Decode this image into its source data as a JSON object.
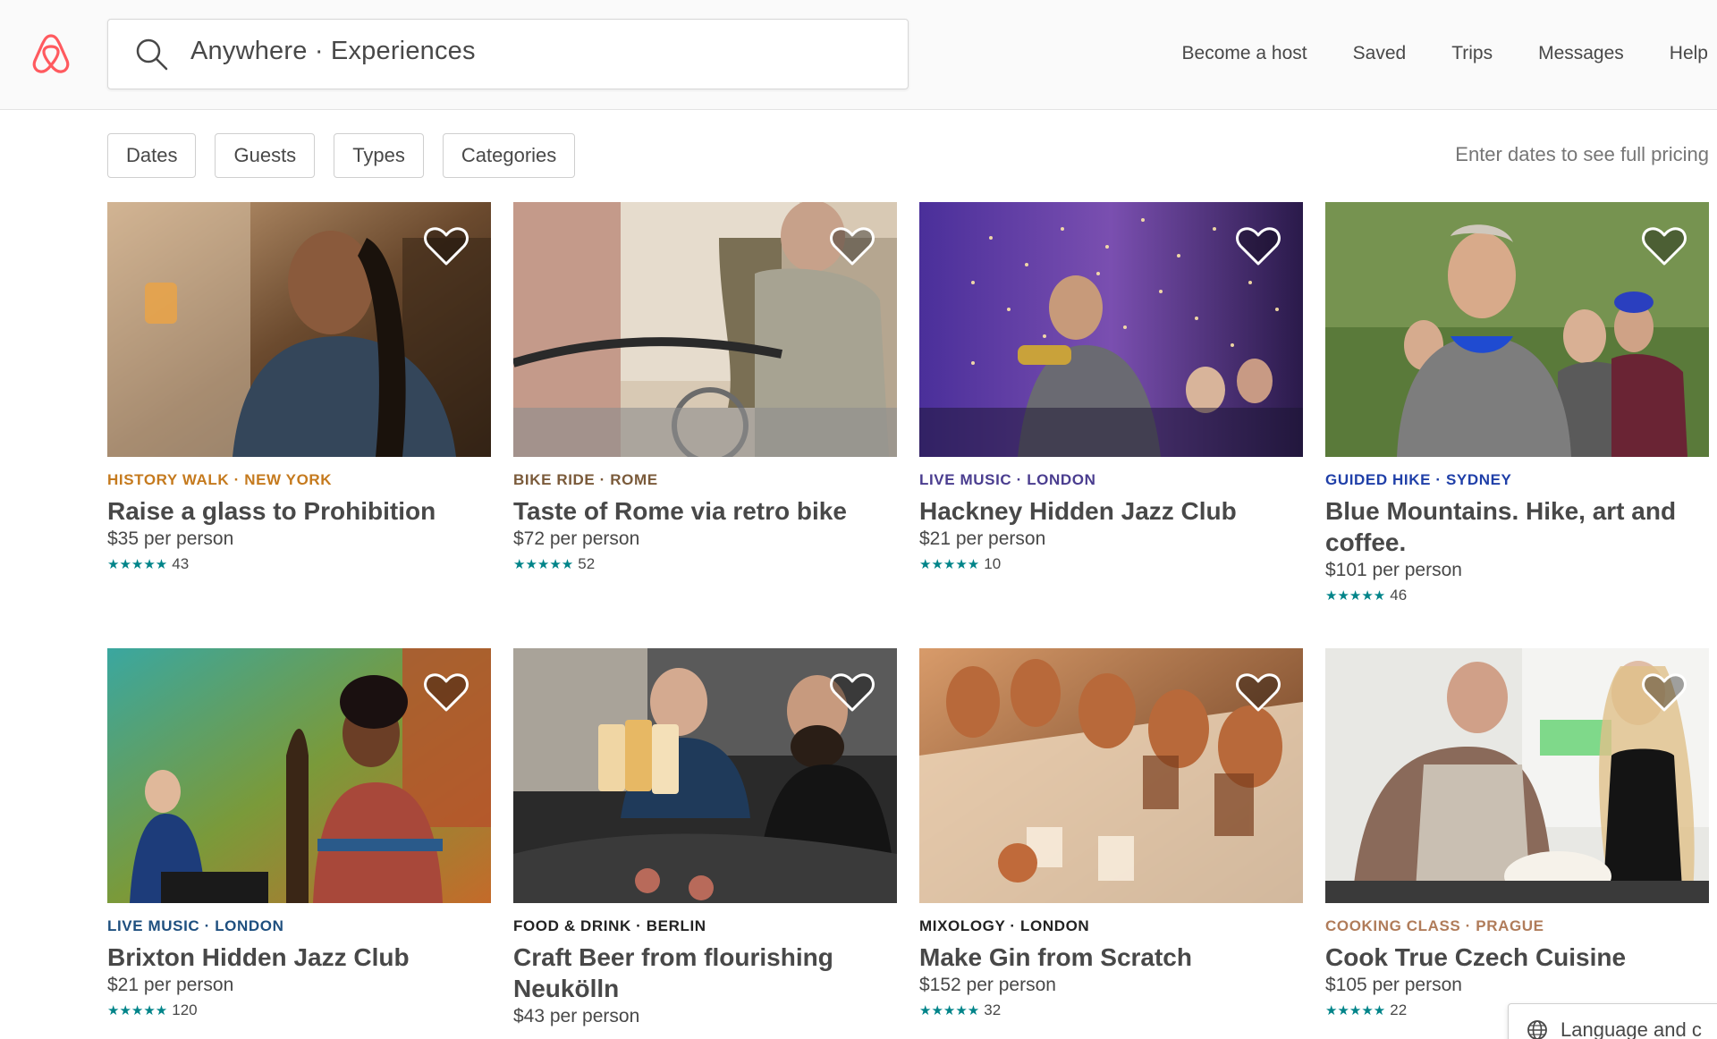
{
  "header": {
    "search_text": "Anywhere · Experiences",
    "nav": [
      "Become a host",
      "Saved",
      "Trips",
      "Messages",
      "Help"
    ]
  },
  "filters": {
    "buttons": [
      "Dates",
      "Guests",
      "Types",
      "Categories"
    ],
    "pricing_note": "Enter dates to see full pricing"
  },
  "listings": [
    {
      "category": "HISTORY WALK · NEW YORK",
      "category_color": "#c57a1e",
      "title": "Raise a glass to Prohibition",
      "price": "$35 per person",
      "stars": "★★★★★",
      "reviews": "43"
    },
    {
      "category": "BIKE RIDE · ROME",
      "category_color": "#7a5a3a",
      "title": "Taste of Rome via retro bike",
      "price": "$72 per person",
      "stars": "★★★★★",
      "reviews": "52"
    },
    {
      "category": "LIVE MUSIC · LONDON",
      "category_color": "#4a3d8f",
      "title": "Hackney Hidden Jazz Club",
      "price": "$21 per person",
      "stars": "★★★★★",
      "reviews": "10"
    },
    {
      "category": "GUIDED HIKE · SYDNEY",
      "category_color": "#1f3fa8",
      "title": "Blue Mountains. Hike, art and coffee.",
      "price": "$101 per person",
      "stars": "★★★★★",
      "reviews": "46"
    },
    {
      "category": "LIVE MUSIC · LONDON",
      "category_color": "#1e4f7f",
      "title": "Brixton Hidden Jazz Club",
      "price": "$21 per person",
      "stars": "★★★★★",
      "reviews": "120"
    },
    {
      "category": "FOOD & DRINK · BERLIN",
      "category_color": "#222222",
      "title": "Craft Beer from flourishing Neukölln",
      "price": "$43 per person",
      "stars": "★★★★★",
      "reviews": ""
    },
    {
      "category": "MIXOLOGY · LONDON",
      "category_color": "#222222",
      "title": "Make Gin from Scratch",
      "price": "$152 per person",
      "stars": "★★★★★",
      "reviews": "32"
    },
    {
      "category": "COOKING CLASS · PRAGUE",
      "category_color": "#b07c5a",
      "title": "Cook True Czech Cuisine",
      "price": "$105 per person",
      "stars": "★★★★★",
      "reviews": "22"
    }
  ],
  "footer": {
    "language_button": "Language and c"
  },
  "colors": {
    "brand": "#ff5a5f",
    "star": "#008489"
  }
}
